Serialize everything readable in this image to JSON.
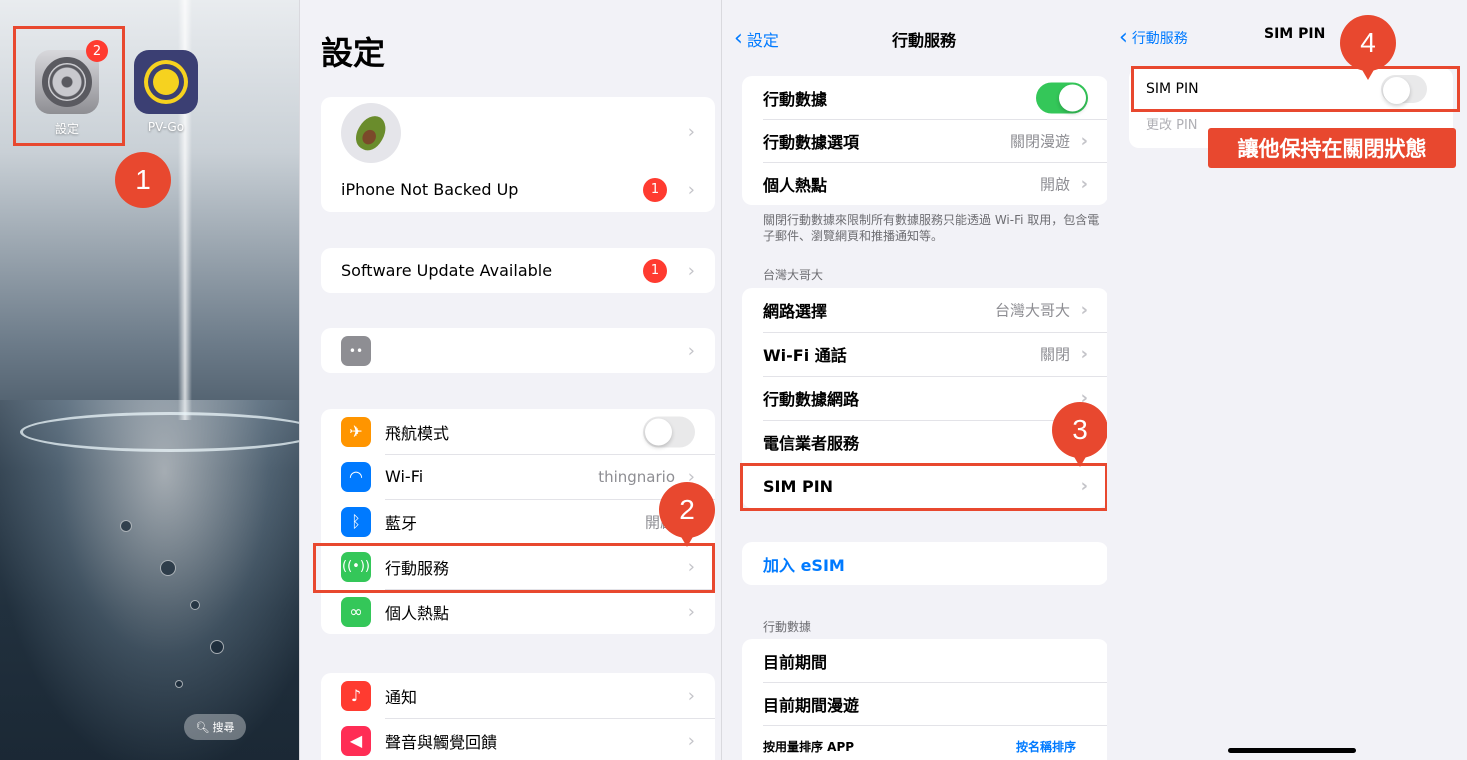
{
  "home": {
    "apps": [
      {
        "label": "設定",
        "icon": "settings-gear-icon",
        "badge": "2"
      },
      {
        "label": "PV-Go",
        "icon": "sun-icon"
      }
    ],
    "search_label": "搜尋"
  },
  "settings": {
    "title": "設定",
    "account": {
      "backup_label": "iPhone Not Backed Up",
      "backup_badge": "1"
    },
    "update": {
      "label": "Software Update Available",
      "badge": "1"
    },
    "connectivity": [
      {
        "label": "飛航模式",
        "icon": "airplane-icon",
        "color": "#ff9500",
        "toggle": "off"
      },
      {
        "label": "Wi-Fi",
        "icon": "wifi-icon",
        "color": "#007aff",
        "value": "thingnario"
      },
      {
        "label": "藍牙",
        "icon": "bluetooth-icon",
        "color": "#007aff",
        "value": "開啟"
      },
      {
        "label": "行動服務",
        "icon": "antenna-icon",
        "color": "#34c759"
      },
      {
        "label": "個人熱點",
        "icon": "hotspot-link-icon",
        "color": "#34c759"
      }
    ],
    "notifications": [
      {
        "label": "通知",
        "icon": "bell-icon",
        "color": "#ff3b30"
      },
      {
        "label": "聲音與觸覺回饋",
        "icon": "speaker-icon",
        "color": "#ff2d55"
      }
    ]
  },
  "cellular": {
    "back_label": "設定",
    "title": "行動服務",
    "group1": [
      {
        "label": "行動數據",
        "toggle": "on"
      },
      {
        "label": "行動數據選項",
        "value": "關閉漫遊"
      },
      {
        "label": "個人熱點",
        "value": "開啟"
      }
    ],
    "note": "關閉行動數據來限制所有數據服務只能透過 Wi-Fi 取用，包含電子郵件、瀏覽網頁和推播通知等。",
    "carrier_header": "台灣大哥大",
    "group2": [
      {
        "label": "網路選擇",
        "value": "台灣大哥大"
      },
      {
        "label": "Wi-Fi 通話",
        "value": "關閉"
      },
      {
        "label": "行動數據網路"
      },
      {
        "label": "電信業者服務"
      },
      {
        "label": "SIM PIN"
      }
    ],
    "esim_label": "加入 eSIM",
    "data_header": "行動數據",
    "group3": [
      {
        "label": "目前期間"
      },
      {
        "label": "目前期間漫遊"
      }
    ],
    "sort_label": "按用量排序 APP",
    "sort_link": "按名稱排序"
  },
  "simpin": {
    "back_label": "行動服務",
    "title": "SIM PIN",
    "toggle_label": "SIM PIN",
    "toggle_state": "off",
    "change_pin": "更改 PIN",
    "callout": "讓他保持在關閉狀態"
  },
  "steps": [
    "1",
    "2",
    "3",
    "4"
  ],
  "colors": {
    "highlight": "#e8482f",
    "link": "#007aff",
    "toggle_on": "#34c759"
  }
}
